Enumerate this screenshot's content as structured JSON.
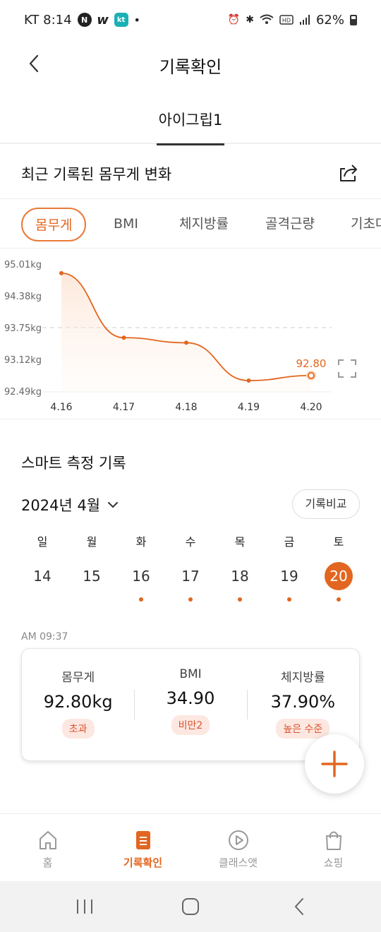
{
  "status_bar": {
    "carrier_time": "KT 8:14",
    "app_badges": [
      "N",
      "w",
      "kt"
    ],
    "dot": "•",
    "battery": "62%",
    "icons": [
      "alarm-icon",
      "bluetooth-icon",
      "wifi-icon",
      "hd-icon",
      "signal-icon",
      "battery-icon"
    ]
  },
  "header": {
    "title": "기록확인",
    "back_icon": "back-arrow-icon"
  },
  "profile_tab": {
    "label": "아이그립1"
  },
  "weight_section": {
    "title": "최근 기록된 몸무게 변화",
    "share_icon": "share-icon"
  },
  "metric_tabs": [
    {
      "label": "몸무게",
      "active": true
    },
    {
      "label": "BMI",
      "active": false
    },
    {
      "label": "체지방률",
      "active": false
    },
    {
      "label": "골격근량",
      "active": false
    },
    {
      "label": "기초대",
      "active": false
    }
  ],
  "chart_data": {
    "type": "line",
    "y_ticks": [
      "95.01kg",
      "94.38kg",
      "93.75kg",
      "93.12kg",
      "92.49kg"
    ],
    "ylim": [
      92.49,
      95.01
    ],
    "x": [
      "4.16",
      "4.17",
      "4.18",
      "4.19",
      "4.20"
    ],
    "values": [
      94.83,
      93.55,
      93.45,
      92.7,
      92.8
    ],
    "highlight_label": "92.80",
    "reference_line": 93.75,
    "color": "#e2661f"
  },
  "smart_section": {
    "title": "스마트 측정 기록",
    "month": "2024년 4월",
    "compare_button": "기록비교",
    "week": [
      {
        "wd": "일",
        "day": "14",
        "has_record": false,
        "selected": false
      },
      {
        "wd": "월",
        "day": "15",
        "has_record": false,
        "selected": false
      },
      {
        "wd": "화",
        "day": "16",
        "has_record": true,
        "selected": false
      },
      {
        "wd": "수",
        "day": "17",
        "has_record": true,
        "selected": false
      },
      {
        "wd": "목",
        "day": "18",
        "has_record": true,
        "selected": false
      },
      {
        "wd": "금",
        "day": "19",
        "has_record": true,
        "selected": false
      },
      {
        "wd": "토",
        "day": "20",
        "has_record": true,
        "selected": true
      }
    ]
  },
  "record": {
    "time": "AM 09:37",
    "metrics": [
      {
        "label": "몸무게",
        "value": "92.80kg",
        "status": "초과"
      },
      {
        "label": "BMI",
        "value": "34.90",
        "status": "비만2"
      },
      {
        "label": "체지방률",
        "value": "37.90%",
        "status": "높은 수준"
      }
    ]
  },
  "fab": {
    "icon": "plus-icon"
  },
  "bottom_nav": [
    {
      "label": "홈",
      "icon": "home-icon",
      "active": false
    },
    {
      "label": "기록확인",
      "icon": "document-icon",
      "active": true
    },
    {
      "label": "클래스앳",
      "icon": "play-circle-icon",
      "active": false
    },
    {
      "label": "쇼핑",
      "icon": "shopping-bag-icon",
      "active": false
    }
  ],
  "colors": {
    "accent": "#e2661f",
    "badge_bg": "#fde7e1",
    "badge_text": "#d9552f"
  }
}
